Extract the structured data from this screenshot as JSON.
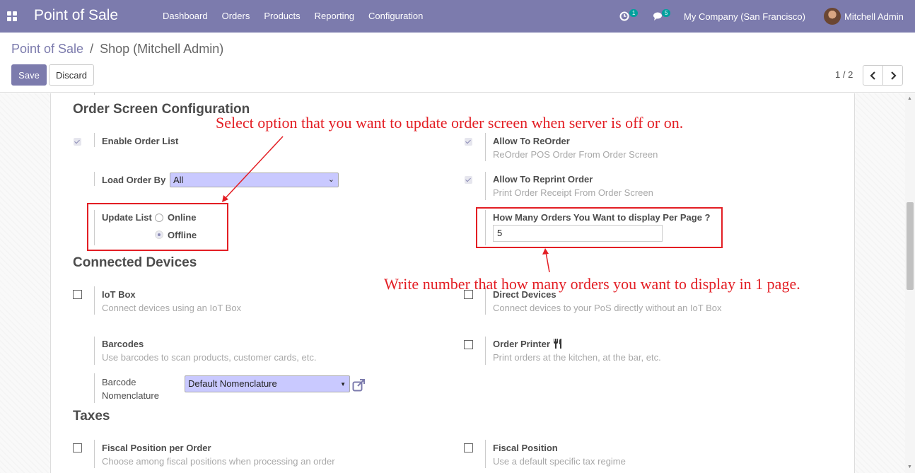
{
  "navbar": {
    "app_name": "Point of Sale",
    "menu": [
      "Dashboard",
      "Orders",
      "Products",
      "Reporting",
      "Configuration"
    ],
    "activity_count": "1",
    "messages_count": "5",
    "company": "My Company (San Francisco)",
    "user": "Mitchell Admin",
    "color": "#7c7bad"
  },
  "breadcrumb": {
    "parent": "Point of Sale",
    "separator": "/",
    "current": "Shop (Mitchell Admin)"
  },
  "buttons": {
    "save": "Save",
    "discard": "Discard"
  },
  "pager": {
    "value": "1 / 2"
  },
  "order_screen": {
    "title": "Order Screen Configuration",
    "enable_order_list": {
      "label": "Enable Order List",
      "checked": true
    },
    "load_order_by": {
      "label": "Load Order By",
      "value": "All"
    },
    "update_list": {
      "label": "Update List",
      "options": [
        "Online",
        "Offline"
      ],
      "selected": "Offline"
    },
    "allow_reorder": {
      "label": "Allow To ReOrder",
      "help": "ReOrder POS Order From Order Screen",
      "checked": true
    },
    "allow_reprint": {
      "label": "Allow To Reprint Order",
      "help": "Print Order Receipt From Order Screen",
      "checked": true
    },
    "orders_per_page": {
      "label": "How Many Orders You Want to display Per Page ?",
      "value": "5"
    }
  },
  "connected_devices": {
    "title": "Connected Devices",
    "iot_box": {
      "label": "IoT Box",
      "help": "Connect devices using an IoT Box"
    },
    "direct_devices": {
      "label": "Direct Devices",
      "help": "Connect devices to your PoS directly without an IoT Box"
    },
    "barcodes": {
      "label": "Barcodes",
      "help": "Use barcodes to scan products, customer cards, etc."
    },
    "barcode_nomenclature": {
      "label_line1": "Barcode",
      "label_line2": "Nomenclature",
      "value": "Default Nomenclature"
    },
    "order_printer": {
      "label": "Order Printer",
      "help": "Print orders at the kitchen, at the bar, etc."
    }
  },
  "taxes": {
    "title": "Taxes",
    "fiscal_position_per_order": {
      "label": "Fiscal Position per Order",
      "help": "Choose among fiscal positions when processing an order"
    },
    "fiscal_position": {
      "label": "Fiscal Position",
      "help": "Use a default specific tax regime"
    }
  },
  "annotations": {
    "top": "Select option that you want to update order screen when server is off or on.",
    "bottom": "Write number that how many orders you want to display in 1 page.",
    "color": "#e31e24"
  }
}
